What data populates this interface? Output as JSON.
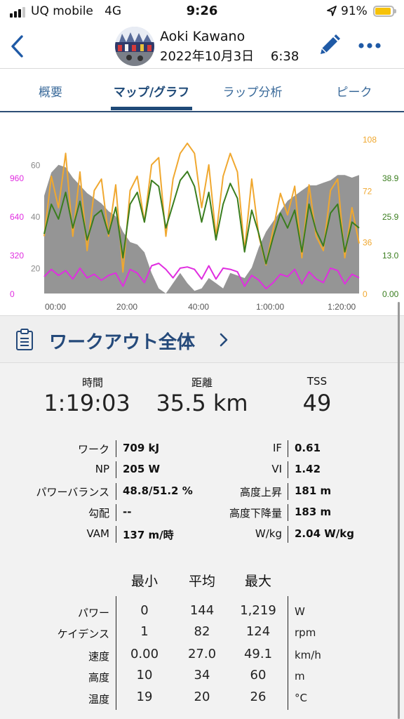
{
  "status_bar": {
    "carrier": "UQ mobile",
    "network": "4G",
    "time": "9:26",
    "battery_percent": "91%",
    "battery_level": 0.91,
    "signal_bars": 3,
    "battery_color": "#f6c20a"
  },
  "header": {
    "user_name": "Aoki Kawano",
    "date_time": "2022年10月3日　 6:38",
    "accent": "#1f5aa6"
  },
  "tabs": [
    {
      "label": "概要",
      "active": false
    },
    {
      "label": "マップ/グラフ",
      "active": true
    },
    {
      "label": "ラップ分析",
      "active": false
    },
    {
      "label": "ピーク",
      "active": false
    }
  ],
  "chart_data": {
    "type": "line",
    "xlabel": "",
    "ylabel": "",
    "grid": false,
    "x_ticks": [
      "00:00",
      "20:00",
      "40:00",
      "1:00:00",
      "1:20:00"
    ],
    "x_tick_minutes": [
      0,
      20,
      40,
      60,
      80
    ],
    "xlim_minutes": [
      0,
      88
    ],
    "axes": {
      "power": {
        "color": "#e02ee0",
        "ticks": [
          "960",
          "640",
          "320",
          "0"
        ],
        "ylim": [
          0,
          1280
        ]
      },
      "elevation": {
        "color": "#8a8a8a",
        "ticks": [
          "60",
          "40",
          "20"
        ],
        "ylim": [
          10,
          70
        ]
      },
      "cadence": {
        "color": "#f0a830",
        "ticks": [
          "108",
          "72",
          "36",
          "0"
        ],
        "ylim": [
          0,
          108
        ]
      },
      "speed": {
        "color": "#3a7d1e",
        "ticks": [
          "38.9",
          "25.9",
          "13.0",
          "0.00"
        ],
        "ylim": [
          0,
          51.9
        ]
      }
    },
    "series": [
      {
        "key": "elevation",
        "color": "#8a8a8a",
        "x": [
          0,
          2,
          4,
          6,
          8,
          10,
          12,
          14,
          16,
          18,
          20,
          22,
          24,
          26,
          28,
          30,
          32,
          34,
          36,
          38,
          40,
          42,
          44,
          46,
          48,
          50,
          52,
          54,
          56,
          58,
          60,
          62,
          64,
          66,
          68,
          70,
          72,
          74,
          76,
          78,
          80,
          82,
          84,
          86,
          88
        ],
        "values": [
          48,
          57,
          60,
          59,
          55,
          52,
          49,
          47,
          45,
          42,
          40,
          34,
          30,
          29,
          26,
          18,
          12,
          10,
          14,
          18,
          14,
          11,
          12,
          16,
          14,
          12,
          18,
          17,
          16,
          20,
          28,
          34,
          38,
          42,
          46,
          48,
          50,
          52,
          52,
          53,
          54,
          56,
          56,
          55,
          56
        ]
      },
      {
        "key": "cadence",
        "color": "#f0a830",
        "x": [
          0,
          2,
          4,
          6,
          8,
          10,
          12,
          14,
          16,
          18,
          20,
          22,
          24,
          26,
          28,
          30,
          32,
          34,
          36,
          38,
          40,
          42,
          44,
          46,
          48,
          50,
          52,
          54,
          56,
          58,
          60,
          62,
          64,
          66,
          68,
          70,
          72,
          74,
          76,
          78,
          80,
          82,
          84,
          86,
          88
        ],
        "values": [
          40,
          82,
          60,
          98,
          40,
          85,
          30,
          72,
          80,
          40,
          76,
          15,
          72,
          82,
          50,
          90,
          95,
          40,
          80,
          98,
          105,
          98,
          60,
          90,
          40,
          82,
          98,
          85,
          30,
          80,
          40,
          20,
          45,
          70,
          55,
          75,
          25,
          76,
          40,
          30,
          72,
          80,
          25,
          60,
          35
        ]
      },
      {
        "key": "speed",
        "color": "#3a7d1e",
        "x": [
          0,
          2,
          4,
          6,
          8,
          10,
          12,
          14,
          16,
          18,
          20,
          22,
          24,
          26,
          28,
          30,
          32,
          34,
          36,
          38,
          40,
          42,
          44,
          46,
          48,
          50,
          52,
          54,
          56,
          58,
          60,
          62,
          64,
          66,
          68,
          70,
          72,
          74,
          76,
          78,
          80,
          82,
          84,
          86,
          88
        ],
        "values": [
          20,
          30,
          25,
          34,
          22,
          31,
          18,
          26,
          28,
          20,
          29,
          12,
          30,
          34,
          24,
          38,
          36,
          22,
          30,
          38,
          41,
          36,
          24,
          34,
          18,
          30,
          37,
          32,
          14,
          28,
          20,
          10,
          19,
          27,
          22,
          28,
          14,
          30,
          21,
          16,
          27,
          30,
          14,
          24,
          22
        ]
      },
      {
        "key": "power",
        "color": "#e02ee0",
        "x": [
          0,
          2,
          4,
          6,
          8,
          10,
          12,
          14,
          16,
          18,
          20,
          22,
          24,
          26,
          28,
          30,
          32,
          34,
          36,
          38,
          40,
          42,
          44,
          46,
          48,
          50,
          52,
          54,
          56,
          58,
          60,
          62,
          64,
          66,
          68,
          70,
          72,
          74,
          76,
          78,
          80,
          82,
          84,
          86,
          88
        ],
        "values": [
          140,
          200,
          150,
          190,
          120,
          210,
          130,
          160,
          110,
          150,
          170,
          60,
          200,
          170,
          90,
          230,
          250,
          200,
          130,
          210,
          220,
          200,
          120,
          230,
          120,
          210,
          200,
          180,
          60,
          150,
          110,
          40,
          90,
          160,
          140,
          200,
          80,
          180,
          120,
          90,
          210,
          190,
          80,
          160,
          130
        ]
      }
    ]
  },
  "workout": {
    "title": "ワークアウト全体",
    "summary": [
      {
        "label": "時間",
        "value": "1:19:03"
      },
      {
        "label": "距離",
        "value": "35.5 km"
      },
      {
        "label": "TSS",
        "value": "49"
      }
    ],
    "metrics_left": [
      {
        "label": "ワーク",
        "value": "709 kJ"
      },
      {
        "label": "NP",
        "value": "205 W"
      },
      {
        "label": "パワーバランス",
        "value": "48.8/51.2 %"
      },
      {
        "label": "勾配",
        "value": "--"
      },
      {
        "label": "VAM",
        "value": "137 m/時"
      }
    ],
    "metrics_right": [
      {
        "label": "IF",
        "value": "0.61"
      },
      {
        "label": "VI",
        "value": "1.42"
      },
      {
        "label": "高度上昇",
        "value": "181 m"
      },
      {
        "label": "高度下降量",
        "value": "183 m"
      },
      {
        "label": "W/kg",
        "value": "2.04 W/kg"
      }
    ],
    "stats_headers": [
      "最小",
      "平均",
      "最大"
    ],
    "stats": [
      {
        "label": "パワー",
        "min": "0",
        "avg": "144",
        "max": "1,219",
        "unit": "W"
      },
      {
        "label": "ケイデンス",
        "min": "1",
        "avg": "82",
        "max": "124",
        "unit": "rpm"
      },
      {
        "label": "速度",
        "min": "0.00",
        "avg": "27.0",
        "max": "49.1",
        "unit": "km/h"
      },
      {
        "label": "高度",
        "min": "10",
        "avg": "34",
        "max": "60",
        "unit": "m"
      },
      {
        "label": "温度",
        "min": "19",
        "avg": "20",
        "max": "26",
        "unit": "°C"
      }
    ]
  }
}
